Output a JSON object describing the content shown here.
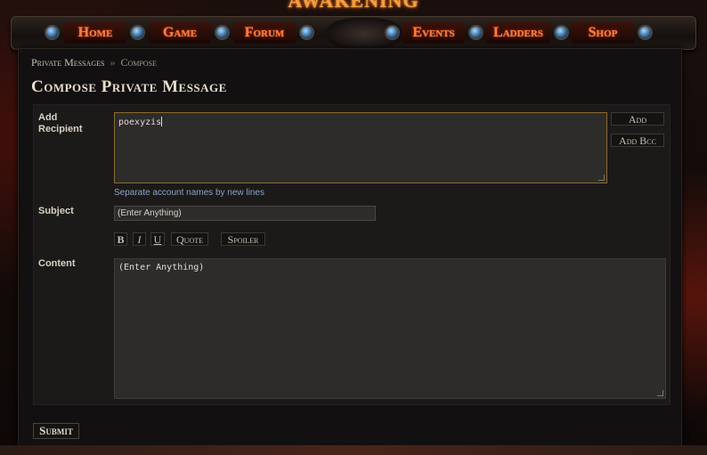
{
  "site": {
    "logo_text": "AWAKENING"
  },
  "nav": {
    "items": [
      {
        "label": "Home"
      },
      {
        "label": "Game"
      },
      {
        "label": "Forum"
      },
      {
        "label": "Events"
      },
      {
        "label": "Ladders"
      },
      {
        "label": "Shop"
      }
    ]
  },
  "breadcrumb": {
    "root": "Private Messages",
    "separator": "»",
    "current": "Compose"
  },
  "page": {
    "title": "Compose Private Message"
  },
  "form": {
    "recipient": {
      "label": "Add Recipient",
      "value": "poexyzis",
      "hint": "Separate account names by new lines",
      "add_label": "Add",
      "add_bcc_label": "Add Bcc"
    },
    "subject": {
      "label": "Subject",
      "value": "(Enter Anything)"
    },
    "formatting": {
      "bold": "B",
      "italic": "I",
      "underline": "U",
      "quote": "Quote",
      "spoiler": "Spoiler"
    },
    "content": {
      "label": "Content",
      "value": "(Enter Anything)"
    },
    "submit_label": "Submit"
  },
  "colors": {
    "nav_text": "#ff7a3c",
    "accent_border": "#8a6a2c",
    "hint": "#8aa2c4"
  }
}
